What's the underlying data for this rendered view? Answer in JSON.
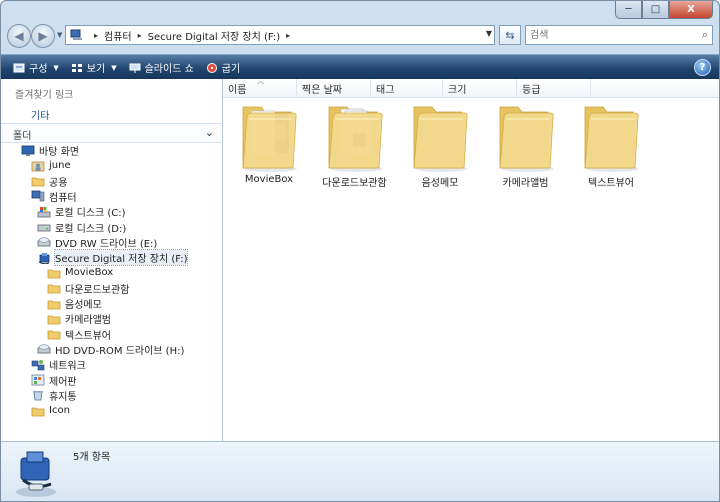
{
  "window": {
    "caption_minimize": "─",
    "caption_maximize": "□",
    "caption_close": "X"
  },
  "address": {
    "crumbs": [
      "컴퓨터",
      "Secure Digital 저장 장치 (F:)"
    ],
    "search_placeholder": "검색"
  },
  "toolbar": {
    "organize": "구성",
    "views": "보기",
    "slideshow": "슬라이드 쇼",
    "burn": "굽기",
    "help": "?"
  },
  "nav": {
    "favorites_header": "즐겨찾기 링크",
    "favorites_more": "기타",
    "folders_header": "폴더",
    "tree": [
      {
        "label": "바탕 화면",
        "icon": "desktop-icon",
        "level": 0
      },
      {
        "label": "june",
        "icon": "user-folder-icon",
        "level": 1
      },
      {
        "label": "공용",
        "icon": "folder-icon",
        "level": 1
      },
      {
        "label": "컴퓨터",
        "icon": "computer-icon",
        "level": 1
      },
      {
        "label": "로컬 디스크 (C:)",
        "icon": "system-drive-icon",
        "level": 2
      },
      {
        "label": "로컬 디스크 (D:)",
        "icon": "drive-icon",
        "level": 2
      },
      {
        "label": "DVD RW 드라이브 (E:)",
        "icon": "dvd-drive-icon",
        "level": 2
      },
      {
        "label": "Secure Digital 저장 장치 (F:)",
        "icon": "sd-card-icon",
        "level": 2,
        "selected": true
      },
      {
        "label": "MovieBox",
        "icon": "folder-icon",
        "level": 3
      },
      {
        "label": "다운로드보관함",
        "icon": "folder-icon",
        "level": 3
      },
      {
        "label": "음성메모",
        "icon": "folder-icon",
        "level": 3
      },
      {
        "label": "카메라앨범",
        "icon": "folder-icon",
        "level": 3
      },
      {
        "label": "텍스트뷰어",
        "icon": "folder-icon",
        "level": 3
      },
      {
        "label": "HD DVD-ROM 드라이브 (H:)",
        "icon": "dvd-drive-icon",
        "level": 2
      },
      {
        "label": "네트워크",
        "icon": "network-icon",
        "level": 1
      },
      {
        "label": "제어판",
        "icon": "control-panel-icon",
        "level": 1
      },
      {
        "label": "휴지통",
        "icon": "recycle-bin-icon",
        "level": 1
      },
      {
        "label": "Icon",
        "icon": "folder-icon",
        "level": 1
      }
    ]
  },
  "columns": [
    "이름",
    "찍은 날짜",
    "태그",
    "크기",
    "등급"
  ],
  "items": [
    {
      "name": "MovieBox",
      "variant": "movie"
    },
    {
      "name": "다운로드보관함",
      "variant": "docs"
    },
    {
      "name": "음성메모",
      "variant": "plain"
    },
    {
      "name": "카메라앨범",
      "variant": "plain"
    },
    {
      "name": "텍스트뷰어",
      "variant": "plain"
    }
  ],
  "status": {
    "count": "5개 항목"
  },
  "colors": {
    "command_bar": "#21456f",
    "folder": "#f0d27a",
    "link": "#1d4f96"
  }
}
